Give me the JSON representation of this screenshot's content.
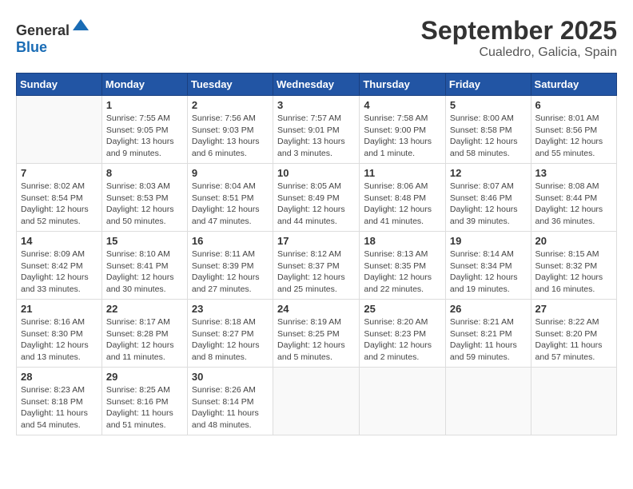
{
  "header": {
    "logo": {
      "general": "General",
      "blue": "Blue"
    },
    "title": "September 2025",
    "location": "Cualedro, Galicia, Spain"
  },
  "calendar": {
    "headers": [
      "Sunday",
      "Monday",
      "Tuesday",
      "Wednesday",
      "Thursday",
      "Friday",
      "Saturday"
    ],
    "weeks": [
      [
        {
          "day": "",
          "info": ""
        },
        {
          "day": "1",
          "info": "Sunrise: 7:55 AM\nSunset: 9:05 PM\nDaylight: 13 hours\nand 9 minutes."
        },
        {
          "day": "2",
          "info": "Sunrise: 7:56 AM\nSunset: 9:03 PM\nDaylight: 13 hours\nand 6 minutes."
        },
        {
          "day": "3",
          "info": "Sunrise: 7:57 AM\nSunset: 9:01 PM\nDaylight: 13 hours\nand 3 minutes."
        },
        {
          "day": "4",
          "info": "Sunrise: 7:58 AM\nSunset: 9:00 PM\nDaylight: 13 hours\nand 1 minute."
        },
        {
          "day": "5",
          "info": "Sunrise: 8:00 AM\nSunset: 8:58 PM\nDaylight: 12 hours\nand 58 minutes."
        },
        {
          "day": "6",
          "info": "Sunrise: 8:01 AM\nSunset: 8:56 PM\nDaylight: 12 hours\nand 55 minutes."
        }
      ],
      [
        {
          "day": "7",
          "info": "Sunrise: 8:02 AM\nSunset: 8:54 PM\nDaylight: 12 hours\nand 52 minutes."
        },
        {
          "day": "8",
          "info": "Sunrise: 8:03 AM\nSunset: 8:53 PM\nDaylight: 12 hours\nand 50 minutes."
        },
        {
          "day": "9",
          "info": "Sunrise: 8:04 AM\nSunset: 8:51 PM\nDaylight: 12 hours\nand 47 minutes."
        },
        {
          "day": "10",
          "info": "Sunrise: 8:05 AM\nSunset: 8:49 PM\nDaylight: 12 hours\nand 44 minutes."
        },
        {
          "day": "11",
          "info": "Sunrise: 8:06 AM\nSunset: 8:48 PM\nDaylight: 12 hours\nand 41 minutes."
        },
        {
          "day": "12",
          "info": "Sunrise: 8:07 AM\nSunset: 8:46 PM\nDaylight: 12 hours\nand 39 minutes."
        },
        {
          "day": "13",
          "info": "Sunrise: 8:08 AM\nSunset: 8:44 PM\nDaylight: 12 hours\nand 36 minutes."
        }
      ],
      [
        {
          "day": "14",
          "info": "Sunrise: 8:09 AM\nSunset: 8:42 PM\nDaylight: 12 hours\nand 33 minutes."
        },
        {
          "day": "15",
          "info": "Sunrise: 8:10 AM\nSunset: 8:41 PM\nDaylight: 12 hours\nand 30 minutes."
        },
        {
          "day": "16",
          "info": "Sunrise: 8:11 AM\nSunset: 8:39 PM\nDaylight: 12 hours\nand 27 minutes."
        },
        {
          "day": "17",
          "info": "Sunrise: 8:12 AM\nSunset: 8:37 PM\nDaylight: 12 hours\nand 25 minutes."
        },
        {
          "day": "18",
          "info": "Sunrise: 8:13 AM\nSunset: 8:35 PM\nDaylight: 12 hours\nand 22 minutes."
        },
        {
          "day": "19",
          "info": "Sunrise: 8:14 AM\nSunset: 8:34 PM\nDaylight: 12 hours\nand 19 minutes."
        },
        {
          "day": "20",
          "info": "Sunrise: 8:15 AM\nSunset: 8:32 PM\nDaylight: 12 hours\nand 16 minutes."
        }
      ],
      [
        {
          "day": "21",
          "info": "Sunrise: 8:16 AM\nSunset: 8:30 PM\nDaylight: 12 hours\nand 13 minutes."
        },
        {
          "day": "22",
          "info": "Sunrise: 8:17 AM\nSunset: 8:28 PM\nDaylight: 12 hours\nand 11 minutes."
        },
        {
          "day": "23",
          "info": "Sunrise: 8:18 AM\nSunset: 8:27 PM\nDaylight: 12 hours\nand 8 minutes."
        },
        {
          "day": "24",
          "info": "Sunrise: 8:19 AM\nSunset: 8:25 PM\nDaylight: 12 hours\nand 5 minutes."
        },
        {
          "day": "25",
          "info": "Sunrise: 8:20 AM\nSunset: 8:23 PM\nDaylight: 12 hours\nand 2 minutes."
        },
        {
          "day": "26",
          "info": "Sunrise: 8:21 AM\nSunset: 8:21 PM\nDaylight: 11 hours\nand 59 minutes."
        },
        {
          "day": "27",
          "info": "Sunrise: 8:22 AM\nSunset: 8:20 PM\nDaylight: 11 hours\nand 57 minutes."
        }
      ],
      [
        {
          "day": "28",
          "info": "Sunrise: 8:23 AM\nSunset: 8:18 PM\nDaylight: 11 hours\nand 54 minutes."
        },
        {
          "day": "29",
          "info": "Sunrise: 8:25 AM\nSunset: 8:16 PM\nDaylight: 11 hours\nand 51 minutes."
        },
        {
          "day": "30",
          "info": "Sunrise: 8:26 AM\nSunset: 8:14 PM\nDaylight: 11 hours\nand 48 minutes."
        },
        {
          "day": "",
          "info": ""
        },
        {
          "day": "",
          "info": ""
        },
        {
          "day": "",
          "info": ""
        },
        {
          "day": "",
          "info": ""
        }
      ]
    ]
  }
}
